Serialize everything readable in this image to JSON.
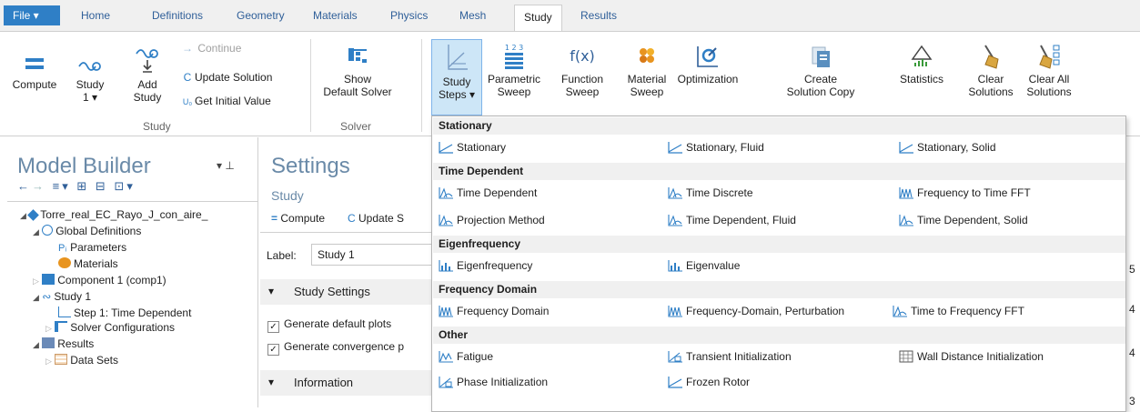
{
  "tabs": {
    "file": "File ▾",
    "items": [
      "Home",
      "Definitions",
      "Geometry",
      "Materials",
      "Physics",
      "Mesh",
      "Study",
      "Results"
    ],
    "active": "Study"
  },
  "ribbon": {
    "compute": "Compute",
    "study1": "Study\n1 ▾",
    "add_study": "Add\nStudy",
    "continue": "Continue",
    "update_solution": "Update Solution",
    "get_initial_value": "Get Initial Value",
    "show_default_solver": "Show\nDefault Solver",
    "study_steps": "Study\nSteps ▾",
    "parametric_sweep": "Parametric\nSweep",
    "function_sweep": "Function\nSweep",
    "material_sweep": "Material\nSweep",
    "optimization": "Optimization",
    "create_solution_copy": "Create\nSolution Copy",
    "statistics": "Statistics",
    "clear_solutions": "Clear\nSolutions",
    "clear_all_solutions": "Clear All\nSolutions",
    "group_study": "Study",
    "group_solver": "Solver"
  },
  "model_builder": {
    "title": "Model Builder",
    "tree": [
      {
        "label": "Torre_real_EC_Rayo_J_con_aire_"
      },
      {
        "label": "Global Definitions"
      },
      {
        "label": "Parameters"
      },
      {
        "label": "Materials"
      },
      {
        "label": "Component 1 (comp1)"
      },
      {
        "label": "Study 1"
      },
      {
        "label": "Step 1: Time Dependent"
      },
      {
        "label": "Solver Configurations"
      },
      {
        "label": "Results"
      },
      {
        "label": "Data Sets"
      }
    ]
  },
  "settings": {
    "title": "Settings",
    "subtitle": "Study",
    "compute": "Compute",
    "update": "Update S",
    "label_caption": "Label:",
    "label_value": "Study 1",
    "section_study_settings": "Study Settings",
    "generate_default_plots": "Generate default plots",
    "generate_convergence": "Generate convergence p",
    "section_information": "Information"
  },
  "dropdown": {
    "sections": [
      {
        "heading": "Stationary",
        "items": [
          "Stationary",
          "Stationary, Fluid",
          "Stationary, Solid"
        ]
      },
      {
        "heading": "Time Dependent",
        "items": [
          "Time Dependent",
          "Time Discrete",
          "Frequency to Time FFT",
          "Projection Method",
          "Time Dependent, Fluid",
          "Time Dependent, Solid"
        ]
      },
      {
        "heading": "Eigenfrequency",
        "items": [
          "Eigenfrequency",
          "Eigenvalue"
        ]
      },
      {
        "heading": "Frequency Domain",
        "items": [
          "Frequency Domain",
          "Frequency-Domain, Perturbation",
          "Time to Frequency FFT"
        ]
      },
      {
        "heading": "Other",
        "items": [
          "Fatigue",
          "Transient Initialization",
          "Wall Distance Initialization",
          "Phase Initialization",
          "Frozen Rotor"
        ]
      }
    ]
  },
  "right_edge": [
    "5",
    "4",
    "4",
    "3"
  ],
  "colors": {
    "accent": "#2f7fc6",
    "selected_bg": "#cde6f7",
    "header_bg": "#f0f0f0",
    "title": "#6a8aa8"
  }
}
